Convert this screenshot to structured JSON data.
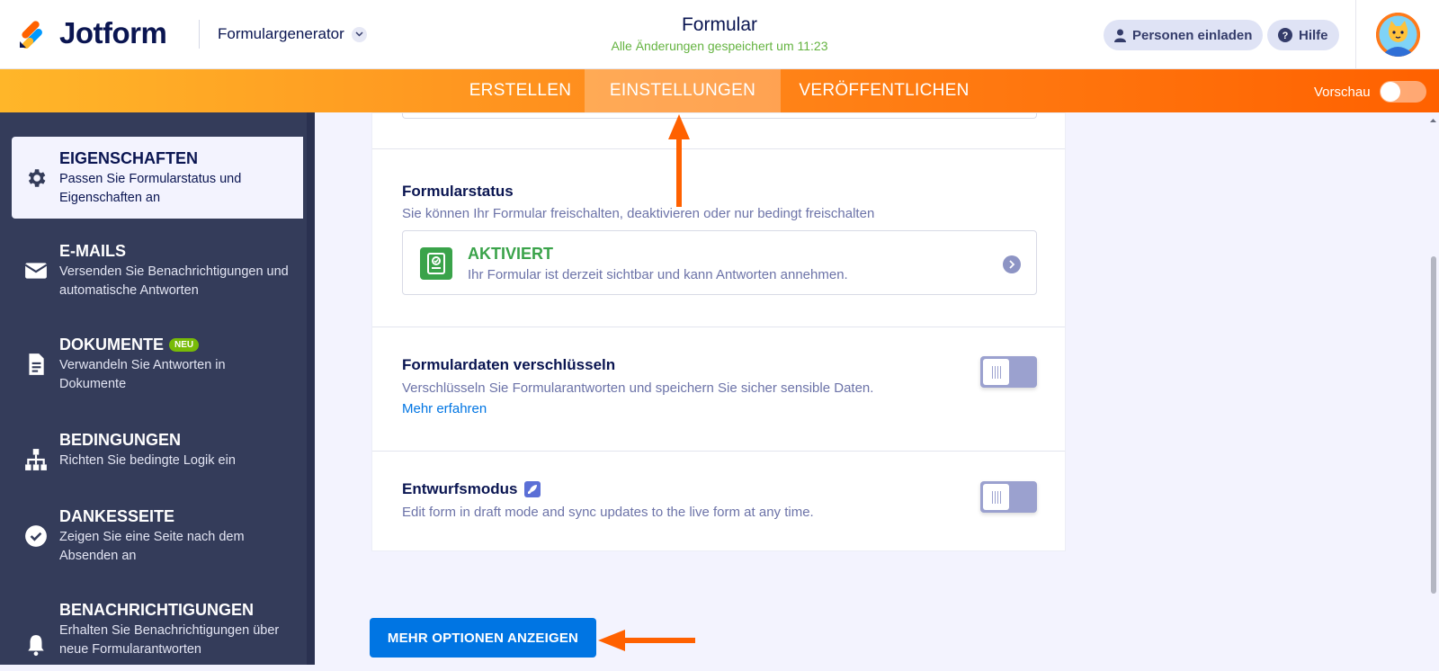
{
  "header": {
    "brand": "Jotform",
    "form_builder": "Formulargenerator",
    "title": "Formular",
    "saved_status": "Alle Änderungen gespeichert um 11:23",
    "invite_label": "Personen einladen",
    "help_label": "Hilfe"
  },
  "nav": {
    "tabs": [
      "ERSTELLEN",
      "EINSTELLUNGEN",
      "VERÖFFENTLICHEN"
    ],
    "active_tab": "EINSTELLUNGEN",
    "preview_label": "Vorschau",
    "preview_on": false
  },
  "sidebar": {
    "items": [
      {
        "title": "EIGENSCHAFTEN",
        "desc": "Passen Sie Formularstatus und Eigenschaften an",
        "icon": "gear-icon",
        "active": true
      },
      {
        "title": "E-MAILS",
        "desc": "Versenden Sie Benachrichtigungen und automatische Antworten",
        "icon": "envelope-icon"
      },
      {
        "title": "DOKUMENTE",
        "badge": "NEU",
        "desc": "Verwandeln Sie Antworten in Dokumente",
        "icon": "document-icon"
      },
      {
        "title": "BEDINGUNGEN",
        "desc": "Richten Sie bedingte Logik ein",
        "icon": "hierarchy-icon"
      },
      {
        "title": "DANKESSEITE",
        "desc": "Zeigen Sie eine Seite nach dem Absenden an",
        "icon": "check-circle-icon"
      },
      {
        "title": "BENACHRICHTIGUNGEN",
        "desc": "Erhalten Sie Benachrichtigungen über neue Formularantworten",
        "icon": "bell-icon"
      }
    ]
  },
  "main": {
    "form_status": {
      "title": "Formularstatus",
      "desc": "Sie können Ihr Formular freischalten, deaktivieren oder nur bedingt freischalten",
      "status_label": "AKTIVIERT",
      "status_desc": "Ihr Formular ist derzeit sichtbar und kann Antworten annehmen."
    },
    "encrypt": {
      "title": "Formulardaten verschlüsseln",
      "desc": "Verschlüsseln Sie Formularantworten und speichern Sie sicher sensible Daten.",
      "link": "Mehr erfahren",
      "enabled": false
    },
    "draft": {
      "title": "Entwurfsmodus",
      "desc": "Edit form in draft mode and sync updates to the live form at any time.",
      "enabled": false
    },
    "more_options_button": "MEHR OPTIONEN ANZEIGEN"
  },
  "colors": {
    "accent_orange": "#ff6100",
    "primary_blue": "#0075e3",
    "success_green": "#3aa34a",
    "sidebar_bg": "#343c5a"
  }
}
